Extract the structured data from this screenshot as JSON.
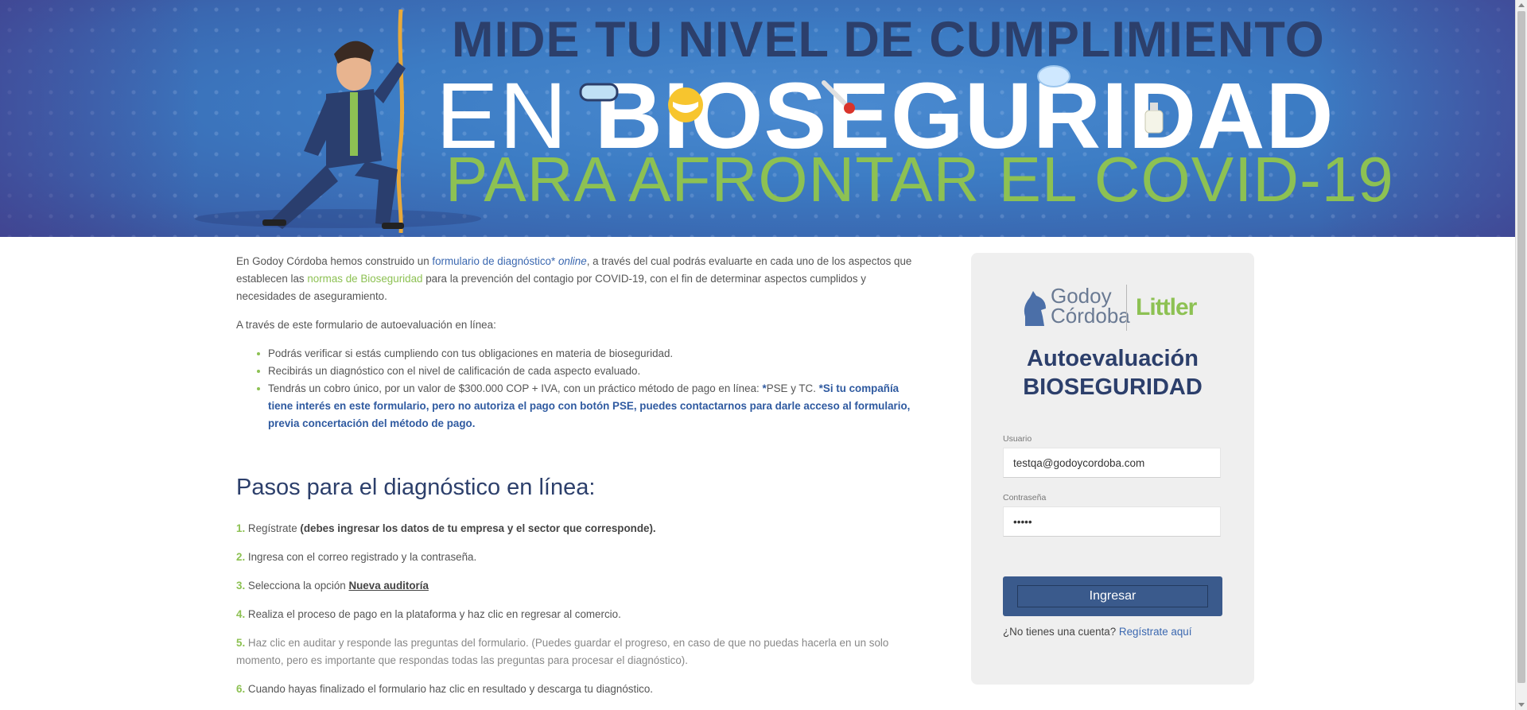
{
  "banner": {
    "line1": "MIDE TU NIVEL DE CUMPLIMIENTO",
    "line2_thin": "EN",
    "line2_bold": "BIOSEGURIDAD",
    "line3": "PARA AFRONTAR EL COVID-19"
  },
  "intro": {
    "p1_before": "En Godoy Córdoba hemos construido un ",
    "p1_link": "formulario de diagnóstico*",
    "p1_em": " online",
    "p1_mid": ", a través del cual podrás evaluarte en cada uno de los aspectos que establecen las ",
    "p1_link2": "normas de Bioseguridad",
    "p1_after": " para la prevención del contagio por COVID-19, con el fin de determinar aspectos cumplidos y necesidades de aseguramiento.",
    "p2": "A través de este formulario de autoevaluación en línea:",
    "bullets": [
      "Podrás verificar si estás cumpliendo con tus obligaciones en materia de bioseguridad.",
      "Recibirás un diagnóstico con el nivel de calificación de cada aspecto evaluado."
    ],
    "bullet3_text": "Tendrás un cobro único, por un valor de $300.000 COP + IVA, con un práctico método de pago en línea: ",
    "bullet3_star": "*",
    "bullet3_pse": "PSE y TC. ",
    "bullet3_bold": "*Si tu compañía tiene interés en este formulario, pero no autoriza el pago con botón PSE, puedes contactarnos para darle acceso al formulario, previa concertación del método de pago."
  },
  "steps": {
    "heading": "Pasos para el diagnóstico en línea:",
    "s1_num": "1.",
    "s1_text": " Regístrate ",
    "s1_bold": "(debes ingresar los datos de tu empresa y el sector que corresponde).",
    "s2_num": "2.",
    "s2_text": " Ingresa con el correo registrado y la contraseña.",
    "s3_num": "3.",
    "s3_text": " Selecciona la opción ",
    "s3_link": "Nueva auditoría",
    "s4_num": "4.",
    "s4_text": " Realiza el proceso de pago en la plataforma y haz clic en regresar al comercio.",
    "s5_num": "5.",
    "s5_text": " Haz clic en auditar y responde las preguntas del formulario. (Puedes guardar el progreso, en caso de que no puedas hacerla en un solo momento, pero es importante que respondas todas las preguntas para procesar el diagnóstico).",
    "s6_num": "6.",
    "s6_text": " Cuando hayas finalizado el formulario haz clic en resultado y descarga tu diagnóstico."
  },
  "login": {
    "logo_godoy": "Godoy",
    "logo_cordoba": "Córdoba",
    "logo_littler": "Littler",
    "title_line1": "Autoevaluación",
    "title_line2": "BIOSEGURIDAD",
    "usuario_label": "Usuario",
    "usuario_value": "testqa@godoycordoba.com",
    "password_label": "Contraseña",
    "password_value": "•••••",
    "submit_label": "Ingresar",
    "register_text": "¿No tienes una cuenta? ",
    "register_link": "Regístrate aquí"
  },
  "colors": {
    "brand_navy": "#2c3f6b",
    "brand_green": "#8dc153",
    "link_blue": "#3b68b0",
    "button": "#3a5a8c"
  }
}
